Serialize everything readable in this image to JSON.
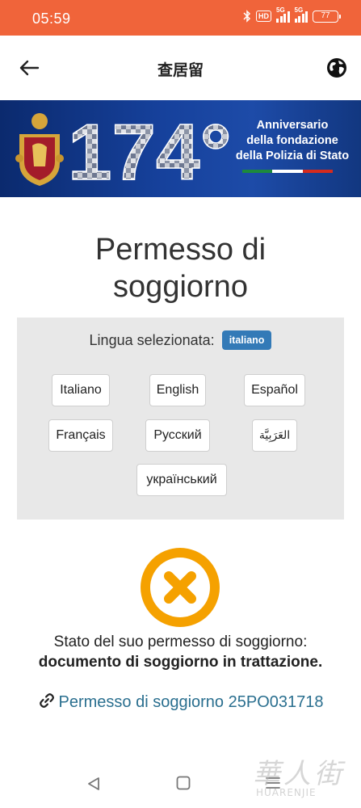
{
  "status_bar": {
    "time": "05:59",
    "hd_label": "HD",
    "signal1_label": "5G",
    "signal2_label": "5G",
    "battery": "77"
  },
  "app_bar": {
    "title": "查居留",
    "back_icon": "arrow-left-icon",
    "globe_icon": "globe-icon"
  },
  "banner": {
    "line1": "Anniversario",
    "line2": "della fondazione",
    "line3": "della Polizia di Stato",
    "graphic_text": "174°"
  },
  "page": {
    "title_line1": "Permesso di",
    "title_line2": "soggiorno"
  },
  "language": {
    "selected_label": "Lingua selezionata:",
    "selected_badge": "italiano",
    "options": [
      "Italiano",
      "English",
      "Español",
      "Français",
      "Русский",
      "العَرَبِيَّة",
      "український"
    ]
  },
  "status": {
    "icon": "x-circle-icon",
    "icon_color": "#f5a100",
    "line1": "Stato del suo permesso di soggiorno:",
    "line2": "documento di soggiorno in trattazione."
  },
  "link": {
    "text": "Permesso di soggiorno 25PO031718",
    "icon": "link-icon",
    "color": "#2a6f8f"
  },
  "watermark": {
    "cn": "華人街",
    "en": "HUARENJIE"
  },
  "colors": {
    "status_bar": "#f0643a",
    "badge": "#337ab7",
    "panel": "#e8e8e8"
  }
}
